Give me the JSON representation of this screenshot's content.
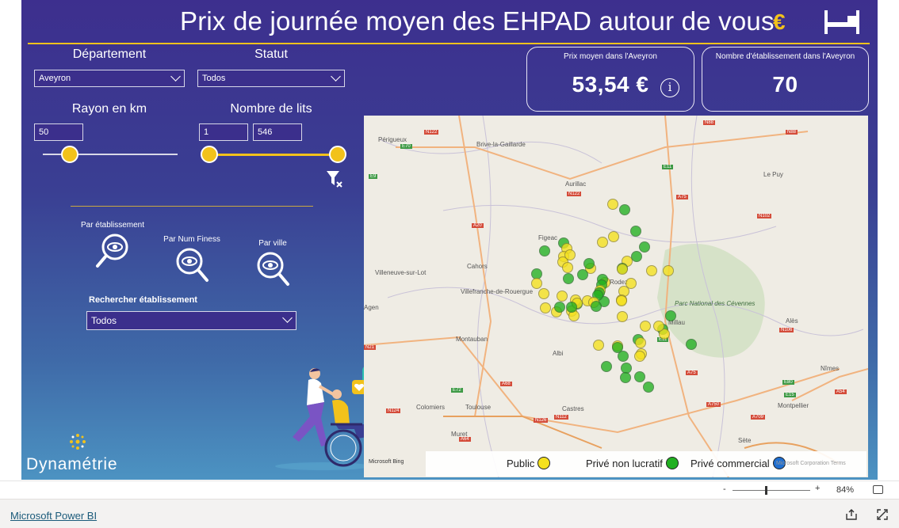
{
  "report": {
    "title": "Prix de journée moyen des EHPAD autour de vous",
    "accent_color": "#f2c21b",
    "background_top": "#3d2f8e",
    "icons": [
      "euro-icon",
      "bed-icon"
    ]
  },
  "filters": {
    "departement_label": "Département",
    "departement_value": "Aveyron",
    "statut_label": "Statut",
    "statut_value": "Todos",
    "rayon_label": "Rayon en km",
    "rayon_value": "50",
    "rayon_level": 0.2,
    "lits_label": "Nombre de lits",
    "lits_min": "1",
    "lits_max": "546",
    "clear_filter_icon": "filter-clear-icon"
  },
  "cards": {
    "prix_caption": "Prix moyen dans l'Aveyron",
    "prix_value": "53,54 €",
    "nombre_caption": "Nombre d'établissement dans l'Aveyron",
    "nombre_value": "70"
  },
  "view_buttons": [
    {
      "label": "Par établissement"
    },
    {
      "label": "Par Num Finess"
    },
    {
      "label": "Par ville"
    }
  ],
  "search": {
    "label": "Rechercher établissement",
    "value": "Todos"
  },
  "map": {
    "places": [
      "Périgueux",
      "Brive-la-Gaillarde",
      "Aurillac",
      "Le Puy",
      "Figeac",
      "Cahors",
      "Villeneuve-sur-Lot",
      "Villefranche-de-Rouergue",
      "Rodez",
      "Agen",
      "Parc National des Cévennes",
      "Millau",
      "Montauban",
      "Albi",
      "Alès",
      "Nîmes",
      "Colomiers",
      "Toulouse",
      "Castres",
      "Muret",
      "Montpellier",
      "Sète"
    ],
    "roads": [
      "E70",
      "N122",
      "N88",
      "E9",
      "E11",
      "A20",
      "N122",
      "A75",
      "N102",
      "N21",
      "E11",
      "N88",
      "A75",
      "N106",
      "A68",
      "E72",
      "N124",
      "A54",
      "E15",
      "E80",
      "A709",
      "A750",
      "N126",
      "N112",
      "A64"
    ],
    "legend": [
      {
        "label": "Public",
        "color": "#f5e11d"
      },
      {
        "label": "Privé non lucratif",
        "color": "#21b021"
      },
      {
        "label": "Privé commercial",
        "color": "#1f6fd1"
      }
    ],
    "attribution": "Microsoft Bing",
    "attribution_right": "Microsoft Corporation  Terms"
  },
  "brand": {
    "name": "Dynamétrie"
  },
  "zoom": {
    "value": "84%",
    "level": 0.84,
    "minus": "-",
    "plus": "+"
  },
  "footer": {
    "link": "Microsoft Power BI"
  }
}
